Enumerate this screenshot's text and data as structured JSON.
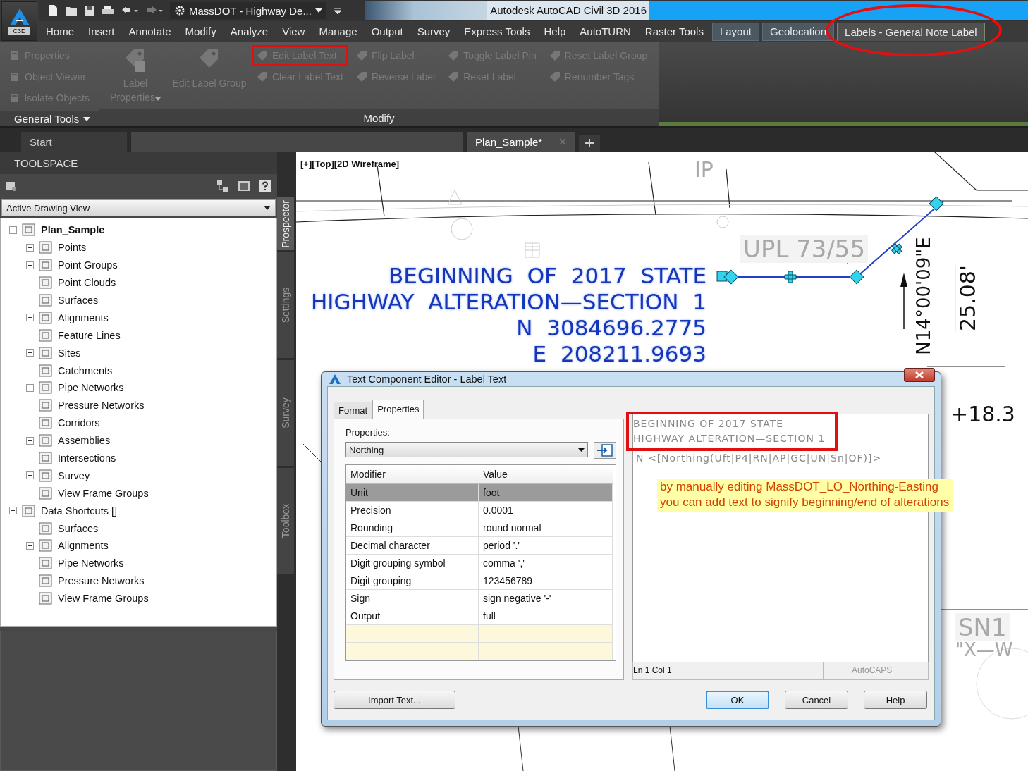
{
  "app_menu": {
    "label": "C3D"
  },
  "quick_access": {
    "workspace": "MassDOT - Highway De..."
  },
  "window": {
    "title": "Autodesk AutoCAD Civil 3D 2016"
  },
  "ribbon_tabs": [
    {
      "label": "Home",
      "selected": false,
      "contextual": false,
      "highlighted": false
    },
    {
      "label": "Insert",
      "selected": false,
      "contextual": false,
      "highlighted": false
    },
    {
      "label": "Annotate",
      "selected": false,
      "contextual": false,
      "highlighted": false
    },
    {
      "label": "Modify",
      "selected": false,
      "contextual": false,
      "highlighted": false
    },
    {
      "label": "Analyze",
      "selected": false,
      "contextual": false,
      "highlighted": false
    },
    {
      "label": "View",
      "selected": false,
      "contextual": false,
      "highlighted": false
    },
    {
      "label": "Manage",
      "selected": false,
      "contextual": false,
      "highlighted": false
    },
    {
      "label": "Output",
      "selected": false,
      "contextual": false,
      "highlighted": false
    },
    {
      "label": "Survey",
      "selected": false,
      "contextual": false,
      "highlighted": false
    },
    {
      "label": "Express Tools",
      "selected": false,
      "contextual": false,
      "highlighted": false
    },
    {
      "label": "Help",
      "selected": false,
      "contextual": false,
      "highlighted": false
    },
    {
      "label": "AutoTURN",
      "selected": false,
      "contextual": false,
      "highlighted": false
    },
    {
      "label": "Raster Tools",
      "selected": false,
      "contextual": false,
      "highlighted": false
    },
    {
      "label": "Layout",
      "selected": false,
      "contextual": true,
      "highlighted": false
    },
    {
      "label": "Geolocation",
      "selected": false,
      "contextual": true,
      "highlighted": false
    },
    {
      "label": "Labels - General Note Label",
      "selected": true,
      "contextual": true,
      "highlighted": true
    }
  ],
  "general_tools": {
    "title": "General Tools",
    "buttons": [
      {
        "label": "Properties",
        "disabled": true
      },
      {
        "label": "Object Viewer",
        "disabled": true
      },
      {
        "label": "Isolate Objects",
        "disabled": true
      }
    ]
  },
  "modify": {
    "title": "Modify",
    "large_buttons": [
      {
        "label": "Label Properties",
        "disabled": true,
        "has_menu": true
      },
      {
        "label": "Edit Label Group",
        "disabled": true,
        "has_menu": false
      }
    ],
    "columns": [
      {
        "buttons": [
          {
            "label": "Edit Label Text",
            "disabled": true,
            "highlighted": true
          },
          {
            "label": "Clear Label Text",
            "disabled": true,
            "highlighted": false
          }
        ]
      },
      {
        "buttons": [
          {
            "label": "Flip Label",
            "disabled": true,
            "highlighted": false
          },
          {
            "label": "Reverse Label",
            "disabled": true,
            "highlighted": false
          }
        ]
      },
      {
        "buttons": [
          {
            "label": "Toggle Label Pin",
            "disabled": true,
            "highlighted": false
          },
          {
            "label": "Reset Label",
            "disabled": true,
            "highlighted": false
          }
        ]
      },
      {
        "buttons": [
          {
            "label": "Reset Label Group",
            "disabled": true,
            "highlighted": false
          },
          {
            "label": "Renumber Tags",
            "disabled": true,
            "highlighted": false
          }
        ]
      }
    ]
  },
  "file_tabs": [
    {
      "label": "Start",
      "selected": false,
      "closable": false
    },
    {
      "label": "Plan_Sample*",
      "selected": true,
      "closable": true
    }
  ],
  "toolspace": {
    "title": "TOOLSPACE",
    "view_select": "Active Drawing View",
    "tree": [
      {
        "label": "Plan_Sample",
        "kind": "group",
        "expanded": true,
        "bold": true,
        "children": [
          {
            "label": "Points",
            "kind": "group",
            "expanded": false,
            "bold": false
          },
          {
            "label": "Point Groups",
            "kind": "group",
            "expanded": false,
            "bold": false
          },
          {
            "label": "Point Clouds",
            "kind": "leaf",
            "bold": false
          },
          {
            "label": "Surfaces",
            "kind": "leaf",
            "bold": false
          },
          {
            "label": "Alignments",
            "kind": "group",
            "expanded": false,
            "bold": false
          },
          {
            "label": "Feature Lines",
            "kind": "leaf",
            "bold": false
          },
          {
            "label": "Sites",
            "kind": "group",
            "expanded": false,
            "bold": false
          },
          {
            "label": "Catchments",
            "kind": "leaf",
            "bold": false
          },
          {
            "label": "Pipe Networks",
            "kind": "group",
            "expanded": false,
            "bold": false
          },
          {
            "label": "Pressure Networks",
            "kind": "leaf",
            "bold": false
          },
          {
            "label": "Corridors",
            "kind": "leaf",
            "bold": false
          },
          {
            "label": "Assemblies",
            "kind": "group",
            "expanded": false,
            "bold": false
          },
          {
            "label": "Intersections",
            "kind": "leaf",
            "bold": false
          },
          {
            "label": "Survey",
            "kind": "group",
            "expanded": false,
            "bold": false
          },
          {
            "label": "View Frame Groups",
            "kind": "leaf",
            "bold": false
          }
        ]
      },
      {
        "label": "Data Shortcuts []",
        "kind": "group",
        "expanded": true,
        "bold": false,
        "children": [
          {
            "label": "Surfaces",
            "kind": "leaf",
            "bold": false
          },
          {
            "label": "Alignments",
            "kind": "group",
            "expanded": false,
            "bold": false
          },
          {
            "label": "Pipe Networks",
            "kind": "leaf",
            "bold": false
          },
          {
            "label": "Pressure Networks",
            "kind": "leaf",
            "bold": false
          },
          {
            "label": "View Frame Groups",
            "kind": "leaf",
            "bold": false
          }
        ]
      }
    ],
    "side_tabs": [
      {
        "label": "Prospector",
        "selected": true
      },
      {
        "label": "Settings",
        "selected": false
      },
      {
        "label": "Survey",
        "selected": false
      },
      {
        "label": "Toolbox",
        "selected": false
      }
    ]
  },
  "canvas": {
    "viewport_label": "[+][Top][2D Wireframe]",
    "label_lines": [
      "BEGINNING OF 2017 STATE",
      "HIGHWAY ALTERATION—SECTION 1",
      "N 3084696.2775",
      "E 208211.9693"
    ],
    "bearing": "N14°00'09\"E",
    "distance": "25.08'",
    "station": "+18.3",
    "background_labels": [
      "IP",
      "UPL 73/55",
      "SN1",
      "\"X—W"
    ]
  },
  "dialog": {
    "title": "Text Component Editor - Label Text",
    "tabs": [
      {
        "label": "Format",
        "selected": false
      },
      {
        "label": "Properties",
        "selected": true
      }
    ],
    "properties_label": "Properties:",
    "property": "Northing",
    "columns": [
      "Modifier",
      "Value"
    ],
    "rows": [
      {
        "modifier": "Unit",
        "value": "foot",
        "selected": true
      },
      {
        "modifier": "Precision",
        "value": "0.0001",
        "selected": false
      },
      {
        "modifier": "Rounding",
        "value": "round normal",
        "selected": false
      },
      {
        "modifier": "Decimal character",
        "value": "period '.'",
        "selected": false
      },
      {
        "modifier": "Digit grouping symbol",
        "value": "comma ','",
        "selected": false
      },
      {
        "modifier": "Digit grouping",
        "value": "123456789",
        "selected": false
      },
      {
        "modifier": "Sign",
        "value": "sign negative '-'",
        "selected": false
      },
      {
        "modifier": "Output",
        "value": "full",
        "selected": false
      }
    ],
    "editor": {
      "lines": [
        {
          "text": "BEGINNING OF 2017 STATE",
          "highlighted": true
        },
        {
          "text": "HIGHWAY ALTERATION—SECTION 1",
          "highlighted": true
        },
        {
          "text": "N <[Northing(Uft|P4|RN|AP|GC|UN|Sn|OF)]>",
          "highlighted": false
        }
      ],
      "cursor_position": "Ln 1 Col 1",
      "caps_status": "AutoCAPS",
      "caps_on": false
    },
    "buttons": [
      {
        "label": "Import Text...",
        "default": false
      },
      {
        "label": "OK",
        "default": true
      },
      {
        "label": "Cancel",
        "default": false
      },
      {
        "label": "Help",
        "default": false
      }
    ]
  },
  "note": {
    "lines": [
      "by manually editing MassDOT_LO_Northing-Easting",
      "you can add text to signify beginning/end of alterations"
    ]
  }
}
